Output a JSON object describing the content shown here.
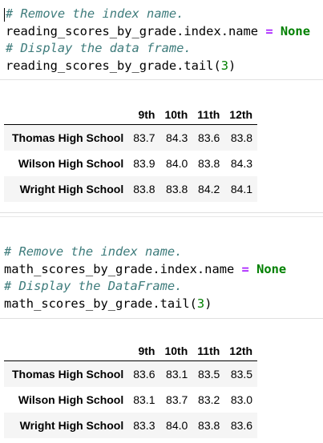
{
  "cells": [
    {
      "code": {
        "comment1": "# Remove the index name.",
        "line2_prefix": "reading_scores_by_grade.index.name",
        "line2_op": "=",
        "line2_kw": "None",
        "comment2": "# Display the data frame.",
        "line4_prefix": "reading_scores_by_grade.tail(",
        "line4_num": "3",
        "line4_suffix": ")"
      },
      "table": {
        "columns": [
          "9th",
          "10th",
          "11th",
          "12th"
        ],
        "rows": [
          {
            "index": "Thomas High School",
            "values": [
              "83.7",
              "84.3",
              "83.6",
              "83.8"
            ]
          },
          {
            "index": "Wilson High School",
            "values": [
              "83.9",
              "84.0",
              "83.8",
              "84.3"
            ]
          },
          {
            "index": "Wright High School",
            "values": [
              "83.8",
              "83.8",
              "84.2",
              "84.1"
            ]
          }
        ]
      }
    },
    {
      "code": {
        "comment1": "# Remove the index name.",
        "line2_prefix": "math_scores_by_grade.index.name",
        "line2_op": "=",
        "line2_kw": "None",
        "comment2": "# Display the DataFrame.",
        "line4_prefix": "math_scores_by_grade.tail(",
        "line4_num": "3",
        "line4_suffix": ")"
      },
      "table": {
        "columns": [
          "9th",
          "10th",
          "11th",
          "12th"
        ],
        "rows": [
          {
            "index": "Thomas High School",
            "values": [
              "83.6",
              "83.1",
              "83.5",
              "83.5"
            ]
          },
          {
            "index": "Wilson High School",
            "values": [
              "83.1",
              "83.7",
              "83.2",
              "83.0"
            ]
          },
          {
            "index": "Wright High School",
            "values": [
              "83.3",
              "84.0",
              "83.8",
              "83.6"
            ]
          }
        ]
      }
    }
  ],
  "colors": {
    "comment": "#3d7b7b",
    "operator": "#aa22ff",
    "keyword": "#008000",
    "row_stripe": "#f5f5f5"
  }
}
